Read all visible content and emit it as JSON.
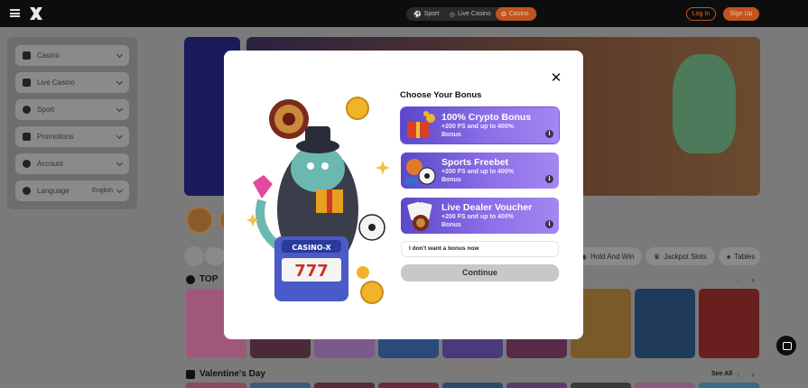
{
  "topbar": {
    "tabs": [
      {
        "label": "Sport",
        "icon": "ball-icon"
      },
      {
        "label": "Live Casino",
        "icon": "live-casino-icon"
      },
      {
        "label": "Casino",
        "icon": "casino-chip-icon",
        "active": true
      }
    ],
    "login_label": "Log In",
    "signup_label": "Sign Up"
  },
  "sidebar": {
    "items": [
      {
        "label": "Casino",
        "icon": "casino-icon"
      },
      {
        "label": "Live Casino",
        "icon": "live-casino-icon"
      },
      {
        "label": "Sport",
        "icon": "sport-ball-icon"
      },
      {
        "label": "Promotions",
        "icon": "promotions-icon"
      },
      {
        "label": "Account",
        "icon": "account-icon"
      },
      {
        "label": "Language",
        "icon": "globe-icon",
        "value": "English"
      }
    ]
  },
  "categories": {
    "chips": [
      "Hold And Win",
      "Jackpot Slots",
      "Tables"
    ]
  },
  "sections": {
    "top_title": "TOP",
    "valentine_title": "Valentine's Day",
    "see_all": "See All"
  },
  "modal": {
    "title": "Choose Your Bonus",
    "bonuses": [
      {
        "name": "100% Crypto Bonus",
        "desc": "+200 FS and up to 400% Bonus",
        "icon": "gift-chest-icon"
      },
      {
        "name": "Sports Freebet",
        "desc": "+200 FS and up to 400% Bonus",
        "icon": "sports-balls-icon"
      },
      {
        "name": "Live Dealer Voucher",
        "desc": "+200 FS and up to 400% Bonus",
        "icon": "roulette-cards-icon"
      }
    ],
    "no_bonus_label": "I don't want a bonus now",
    "continue_label": "Continue"
  },
  "colors": {
    "accent": "#c0541e",
    "bonus_card": "#7a5fe0",
    "continue_disabled": "#c8c8c8"
  }
}
